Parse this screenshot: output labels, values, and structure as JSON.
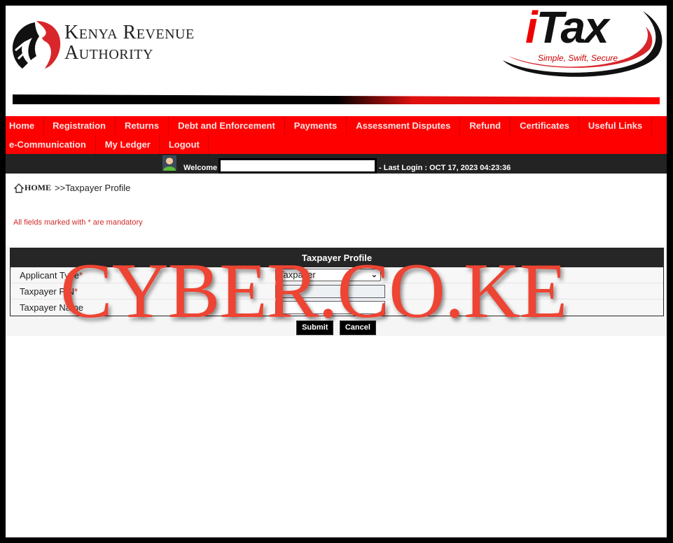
{
  "header": {
    "org_name_line1": "Kenya Revenue",
    "org_name_line2": "Authority",
    "brand": "iTax",
    "brand_tagline": "Simple, Swift, Secure",
    "colors": {
      "accent": "#ff0000",
      "dark_bar": "#232323"
    }
  },
  "nav": {
    "row1": [
      "Home",
      "Registration",
      "Returns",
      "Debt and Enforcement",
      "Payments",
      "Assessment Disputes",
      "Refund",
      "Certificates",
      "Useful Links"
    ],
    "row2": [
      "e-Communication",
      "My Ledger",
      "Logout"
    ]
  },
  "welcome": {
    "label": "Welcome",
    "user_name": "",
    "last_login": "- Last Login : OCT 17, 2023 04:23:36"
  },
  "breadcrumb": {
    "home": "HOME",
    "separator": ">>",
    "current": "Taxpayer Profile"
  },
  "notice": "All fields marked with * are mandatory",
  "form": {
    "title": "Taxpayer Profile",
    "fields": [
      {
        "label": "Applicant Type",
        "required": "*",
        "type": "select",
        "value": "Taxpayer"
      },
      {
        "label": "Taxpayer PIN",
        "required": "*",
        "type": "text",
        "value": ""
      },
      {
        "label": "Taxpayer Name",
        "required": "",
        "type": "text",
        "value": ""
      }
    ],
    "submit_label": "Submit",
    "cancel_label": "Cancel"
  },
  "watermark": "CYBER.CO.KE"
}
